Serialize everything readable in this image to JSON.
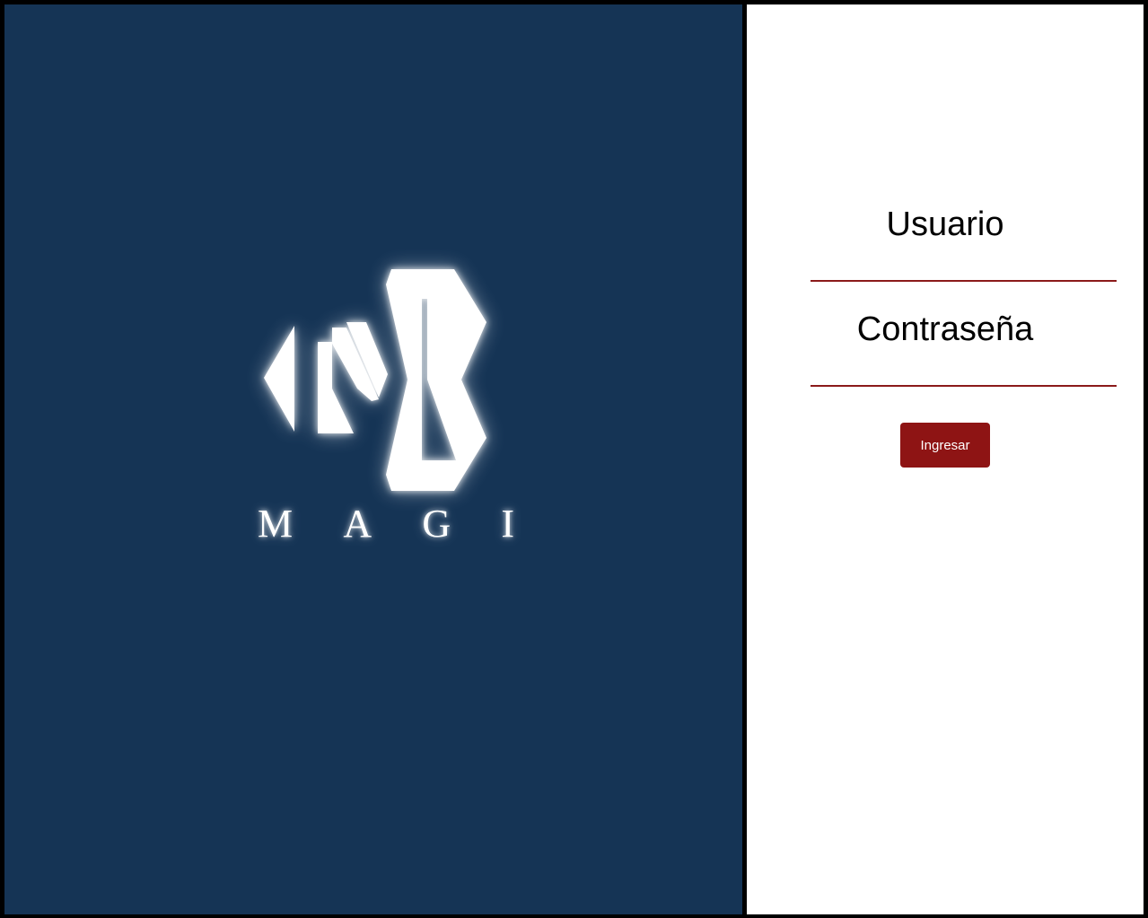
{
  "brand": {
    "name_letters": [
      "M",
      "A",
      "G",
      "I"
    ],
    "logo_icon": "magi-monogram-icon"
  },
  "login": {
    "username_label": "Usuario",
    "username_value": "",
    "password_label": "Contraseña",
    "password_value": "",
    "submit_label": "Ingresar"
  },
  "colors": {
    "left_panel_bg": "#153455",
    "right_panel_bg": "#ffffff",
    "accent": "#8e1414",
    "frame": "#000000"
  }
}
